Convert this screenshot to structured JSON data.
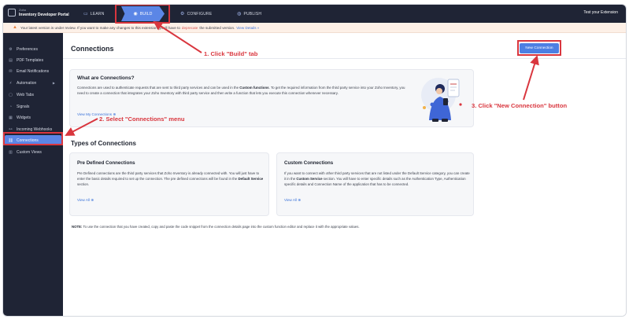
{
  "topbar": {
    "brand_small": "Zoho",
    "brand_main": "Inventory Developer Portal",
    "tabs": [
      {
        "label": "LEARN",
        "icon": "book-icon"
      },
      {
        "label": "BUILD",
        "icon": "build-icon"
      },
      {
        "label": "CONFIGURE",
        "icon": "gear-icon"
      },
      {
        "label": "PUBLISH",
        "icon": "globe-icon"
      }
    ],
    "test_extension": "Test your Extension"
  },
  "banner": {
    "text_before": "Your latest version is under review. If you want to make any changes to this extension, you'll have to",
    "link_red": "deprecate",
    "text_after": "the submitted version.",
    "link_blue": "View Details »"
  },
  "sidebar": {
    "items": [
      {
        "label": "Preferences",
        "icon": "gear-icon"
      },
      {
        "label": "PDF Templates",
        "icon": "document-icon"
      },
      {
        "label": "Email Notifications",
        "icon": "mail-icon"
      },
      {
        "label": "Automation",
        "icon": "automation-icon"
      },
      {
        "label": "Web Tabs",
        "icon": "tab-icon"
      },
      {
        "label": "Signals",
        "icon": "signal-icon"
      },
      {
        "label": "Widgets",
        "icon": "widget-icon"
      },
      {
        "label": "Incoming Webhooks",
        "icon": "webhook-icon"
      },
      {
        "label": "Connections",
        "icon": "connection-icon"
      },
      {
        "label": "Custom Views",
        "icon": "view-icon"
      }
    ],
    "active": "Connections"
  },
  "main": {
    "page_title": "Connections",
    "new_connection_button": "New Connection",
    "what": {
      "title": "What are Connections?",
      "p1": "Connections are used to authenticate requests that are sent to third party services and can be used in the",
      "p1_bold": "Custom functions",
      "p2": ". To get the required information from the third party service into your Zoho Inventory, you need to create a connection that integrates your Zoho Inventory with third party service and then write a function that lets you execute this connection whenever necessary.",
      "link": "View My Connections ⊕"
    },
    "types_title": "Types of Connections",
    "predefined": {
      "title": "Pre Defined Connections",
      "p1": "Pre Defined connections are the third party services that Zoho Inventory is already connected with. You will just have to enter the basic details required to set up the connection. The pre defined connections will be found in the",
      "p1_bold": "Default Service",
      "p2": " section.",
      "link": "View All ⊕"
    },
    "custom": {
      "title": "Custom Connections",
      "p1": "If you want to connect with other third party services that are not listed under the Default Service category, you can create it in the",
      "p1_bold": "Custom Service",
      "p2": " section. You will have to enter specific details such as the Authentication Type, Authentication specific details and Connection Name of the application that has to be connected.",
      "link": "View All ⊕"
    },
    "note_label": "NOTE:",
    "note_text": " To use the connection that you have created, copy and paste the code snippet from the connection details page into the custom function editor and replace it with the appropriate values."
  },
  "annotations": {
    "step1": "1. Click \"Build\" tab",
    "step2": "2. Select \"Connections\" menu",
    "step3": "3. Click \"New Connection\" button"
  },
  "colors": {
    "sidebar_bg": "#1f2435",
    "accent": "#5b86e6",
    "annotation_red": "#d9363e",
    "banner_bg": "#fdf0e7"
  }
}
